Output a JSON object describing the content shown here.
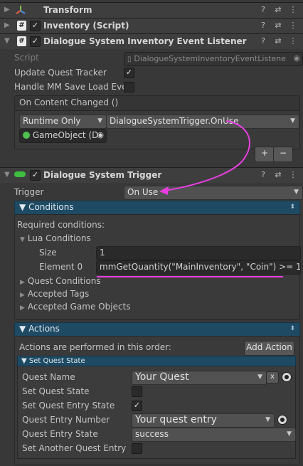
{
  "components": {
    "transform": {
      "title": "Transform"
    },
    "inventory": {
      "title": "Inventory (Script)"
    },
    "listener": {
      "title": "Dialogue System Inventory Event Listener"
    },
    "trigger": {
      "title": "Dialogue System Trigger"
    }
  },
  "listener": {
    "script_label": "Script",
    "script_value": "DialogueSystemInventoryEventListene",
    "update_quest_tracker_label": "Update Quest Tracker",
    "update_quest_tracker_checked": true,
    "handle_mm_label": "Handle MM Save Load Eve",
    "handle_mm_checked": false,
    "event_title": "On Content Changed ()",
    "runtime_mode": "Runtime Only",
    "function": "DialogueSystemTrigger.OnUse",
    "target_object": "GameObject (D",
    "plus_label": "+",
    "minus_label": "−"
  },
  "trigger": {
    "trigger_label": "Trigger",
    "trigger_value": "On Use",
    "conditions_header": "Conditions",
    "required_conditions_label": "Required conditions:",
    "lua_conditions_label": "Lua Conditions",
    "size_label": "Size",
    "size_value": "1",
    "element0_label": "Element 0",
    "element0_value": "mmGetQuantity(\"MainInventory\", \"Coin\") >= 1",
    "quest_conditions_label": "Quest Conditions",
    "accepted_tags_label": "Accepted Tags",
    "accepted_game_objects_label": "Accepted Game Objects",
    "actions_header": "Actions",
    "actions_order_label": "Actions are performed in this order:",
    "add_action_label": "Add Action",
    "set_quest_state_header": "Set Quest State",
    "quest_name_label": "Quest Name",
    "quest_name_value": "Your Quest",
    "remove_label": "x",
    "set_quest_state_label": "Set Quest State",
    "set_quest_state_checked": false,
    "set_quest_entry_state_label": "Set Quest Entry State",
    "set_quest_entry_state_checked": true,
    "quest_entry_number_label": "Quest Entry Number",
    "quest_entry_number_value": "Your quest entry",
    "quest_entry_state_label": "Quest Entry State",
    "quest_entry_state_value": "success",
    "set_another_label": "Set Another Quest Entry Sta",
    "set_another_checked": false
  },
  "icons": {
    "help": "?",
    "settings": "⇄",
    "more": "⋮",
    "expanded": "▼",
    "collapsed": "▶",
    "check": "✓",
    "dropdown": "▼",
    "updown": "⬍"
  },
  "colors": {
    "annotation": "#e83ee0",
    "section_bar": "#1e4a63",
    "background": "#383838"
  }
}
